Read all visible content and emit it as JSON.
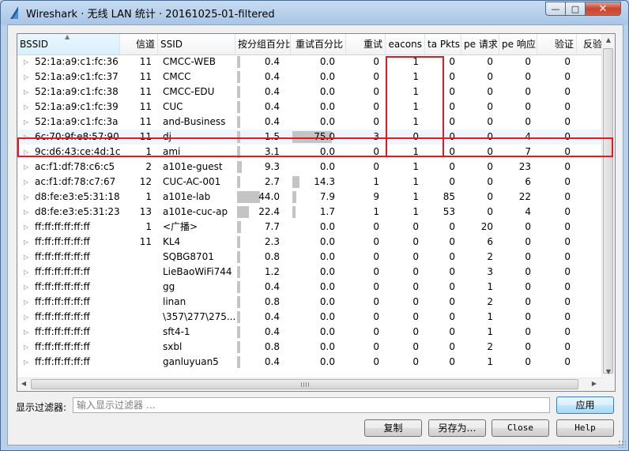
{
  "window": {
    "title": "Wireshark · 无线 LAN 统计 · 20161025-01-filtered",
    "minimize_glyph": "—",
    "maximize_glyph": "□",
    "close_glyph": "✕"
  },
  "columns": [
    "BSSID",
    "信道",
    "SSID",
    "按分组百分比",
    "重试百分比",
    "重试",
    "Beacons",
    "Data Pkts",
    "Probe 请求",
    "Probe 响应",
    "验证",
    "反验证"
  ],
  "columns_visible": [
    "BSSID",
    "信道",
    "SSID",
    "按分组百分比",
    "重试百分比",
    "重试",
    "eacons",
    "ta Pkts",
    "pe 请求",
    "pe 响应",
    "验证",
    "反验证"
  ],
  "sort_column": "BSSID",
  "highlighted_row_index": 5,
  "rows": [
    {
      "bssid": "52:1a:a9:c1:fc:36",
      "channel": "11",
      "ssid": "CMCC-WEB",
      "pct_packets": "0.4",
      "pct_retry": "0.0",
      "retry": "0",
      "beacons": "1",
      "data_pkts": "0",
      "probe_req": "0",
      "probe_resp": "0",
      "auth": "0",
      "deauth": "0",
      "pct_packets_value": 0.4,
      "pct_retry_value": 0.0
    },
    {
      "bssid": "52:1a:a9:c1:fc:37",
      "channel": "11",
      "ssid": "CMCC",
      "pct_packets": "0.4",
      "pct_retry": "0.0",
      "retry": "0",
      "beacons": "1",
      "data_pkts": "0",
      "probe_req": "0",
      "probe_resp": "0",
      "auth": "0",
      "deauth": "0",
      "pct_packets_value": 0.4,
      "pct_retry_value": 0.0
    },
    {
      "bssid": "52:1a:a9:c1:fc:38",
      "channel": "11",
      "ssid": "CMCC-EDU",
      "pct_packets": "0.4",
      "pct_retry": "0.0",
      "retry": "0",
      "beacons": "1",
      "data_pkts": "0",
      "probe_req": "0",
      "probe_resp": "0",
      "auth": "0",
      "deauth": "0",
      "pct_packets_value": 0.4,
      "pct_retry_value": 0.0
    },
    {
      "bssid": "52:1a:a9:c1:fc:39",
      "channel": "11",
      "ssid": "CUC",
      "pct_packets": "0.4",
      "pct_retry": "0.0",
      "retry": "0",
      "beacons": "1",
      "data_pkts": "0",
      "probe_req": "0",
      "probe_resp": "0",
      "auth": "0",
      "deauth": "0",
      "pct_packets_value": 0.4,
      "pct_retry_value": 0.0
    },
    {
      "bssid": "52:1a:a9:c1:fc:3a",
      "channel": "11",
      "ssid": "and-Business",
      "pct_packets": "0.4",
      "pct_retry": "0.0",
      "retry": "0",
      "beacons": "1",
      "data_pkts": "0",
      "probe_req": "0",
      "probe_resp": "0",
      "auth": "0",
      "deauth": "0",
      "pct_packets_value": 0.4,
      "pct_retry_value": 0.0
    },
    {
      "bssid": "6c:70:9f:e8:57:90",
      "channel": "11",
      "ssid": "dj",
      "pct_packets": "1.5",
      "pct_retry": "75.0",
      "retry": "3",
      "beacons": "0",
      "data_pkts": "0",
      "probe_req": "0",
      "probe_resp": "4",
      "auth": "0",
      "deauth": "0",
      "pct_packets_value": 1.5,
      "pct_retry_value": 75.0
    },
    {
      "bssid": "9c:d6:43:ce:4d:1c",
      "channel": "1",
      "ssid": "ami",
      "pct_packets": "3.1",
      "pct_retry": "0.0",
      "retry": "0",
      "beacons": "1",
      "data_pkts": "0",
      "probe_req": "0",
      "probe_resp": "7",
      "auth": "0",
      "deauth": "0",
      "pct_packets_value": 3.1,
      "pct_retry_value": 0.0
    },
    {
      "bssid": "ac:f1:df:78:c6:c5",
      "channel": "2",
      "ssid": "a101e-guest",
      "pct_packets": "9.3",
      "pct_retry": "0.0",
      "retry": "0",
      "beacons": "1",
      "data_pkts": "0",
      "probe_req": "0",
      "probe_resp": "23",
      "auth": "0",
      "deauth": "0",
      "pct_packets_value": 9.3,
      "pct_retry_value": 0.0
    },
    {
      "bssid": "ac:f1:df:78:c7:67",
      "channel": "12",
      "ssid": "CUC-AC-001",
      "pct_packets": "2.7",
      "pct_retry": "14.3",
      "retry": "1",
      "beacons": "1",
      "data_pkts": "0",
      "probe_req": "0",
      "probe_resp": "6",
      "auth": "0",
      "deauth": "0",
      "pct_packets_value": 2.7,
      "pct_retry_value": 14.3
    },
    {
      "bssid": "d8:fe:e3:e5:31:18",
      "channel": "1",
      "ssid": "a101e-lab",
      "pct_packets": "44.0",
      "pct_retry": "7.9",
      "retry": "9",
      "beacons": "1",
      "data_pkts": "85",
      "probe_req": "0",
      "probe_resp": "22",
      "auth": "0",
      "deauth": "0",
      "pct_packets_value": 44.0,
      "pct_retry_value": 7.9
    },
    {
      "bssid": "d8:fe:e3:e5:31:23",
      "channel": "13",
      "ssid": "a101e-cuc-ap",
      "pct_packets": "22.4",
      "pct_retry": "1.7",
      "retry": "1",
      "beacons": "1",
      "data_pkts": "53",
      "probe_req": "0",
      "probe_resp": "4",
      "auth": "0",
      "deauth": "0",
      "pct_packets_value": 22.4,
      "pct_retry_value": 1.7
    },
    {
      "bssid": "ff:ff:ff:ff:ff:ff",
      "channel": "1",
      "ssid": "<广播>",
      "pct_packets": "7.7",
      "pct_retry": "0.0",
      "retry": "0",
      "beacons": "0",
      "data_pkts": "0",
      "probe_req": "20",
      "probe_resp": "0",
      "auth": "0",
      "deauth": "0",
      "pct_packets_value": 7.7,
      "pct_retry_value": 0.0
    },
    {
      "bssid": "ff:ff:ff:ff:ff:ff",
      "channel": "11",
      "ssid": "KL4",
      "pct_packets": "2.3",
      "pct_retry": "0.0",
      "retry": "0",
      "beacons": "0",
      "data_pkts": "0",
      "probe_req": "6",
      "probe_resp": "0",
      "auth": "0",
      "deauth": "0",
      "pct_packets_value": 2.3,
      "pct_retry_value": 0.0
    },
    {
      "bssid": "ff:ff:ff:ff:ff:ff",
      "channel": "",
      "ssid": "SQBG8701",
      "pct_packets": "0.8",
      "pct_retry": "0.0",
      "retry": "0",
      "beacons": "0",
      "data_pkts": "0",
      "probe_req": "2",
      "probe_resp": "0",
      "auth": "0",
      "deauth": "0",
      "pct_packets_value": 0.8,
      "pct_retry_value": 0.0
    },
    {
      "bssid": "ff:ff:ff:ff:ff:ff",
      "channel": "",
      "ssid": "LieBaoWiFi744",
      "pct_packets": "1.2",
      "pct_retry": "0.0",
      "retry": "0",
      "beacons": "0",
      "data_pkts": "0",
      "probe_req": "3",
      "probe_resp": "0",
      "auth": "0",
      "deauth": "0",
      "pct_packets_value": 1.2,
      "pct_retry_value": 0.0
    },
    {
      "bssid": "ff:ff:ff:ff:ff:ff",
      "channel": "",
      "ssid": "gg",
      "pct_packets": "0.4",
      "pct_retry": "0.0",
      "retry": "0",
      "beacons": "0",
      "data_pkts": "0",
      "probe_req": "1",
      "probe_resp": "0",
      "auth": "0",
      "deauth": "0",
      "pct_packets_value": 0.4,
      "pct_retry_value": 0.0
    },
    {
      "bssid": "ff:ff:ff:ff:ff:ff",
      "channel": "",
      "ssid": "linan",
      "pct_packets": "0.8",
      "pct_retry": "0.0",
      "retry": "0",
      "beacons": "0",
      "data_pkts": "0",
      "probe_req": "2",
      "probe_resp": "0",
      "auth": "0",
      "deauth": "0",
      "pct_packets_value": 0.8,
      "pct_retry_value": 0.0
    },
    {
      "bssid": "ff:ff:ff:ff:ff:ff",
      "channel": "",
      "ssid": "\\357\\277\\275...",
      "pct_packets": "0.4",
      "pct_retry": "0.0",
      "retry": "0",
      "beacons": "0",
      "data_pkts": "0",
      "probe_req": "1",
      "probe_resp": "0",
      "auth": "0",
      "deauth": "0",
      "pct_packets_value": 0.4,
      "pct_retry_value": 0.0
    },
    {
      "bssid": "ff:ff:ff:ff:ff:ff",
      "channel": "",
      "ssid": "sft4-1",
      "pct_packets": "0.4",
      "pct_retry": "0.0",
      "retry": "0",
      "beacons": "0",
      "data_pkts": "0",
      "probe_req": "1",
      "probe_resp": "0",
      "auth": "0",
      "deauth": "0",
      "pct_packets_value": 0.4,
      "pct_retry_value": 0.0
    },
    {
      "bssid": "ff:ff:ff:ff:ff:ff",
      "channel": "",
      "ssid": "sxbl",
      "pct_packets": "0.8",
      "pct_retry": "0.0",
      "retry": "0",
      "beacons": "0",
      "data_pkts": "0",
      "probe_req": "2",
      "probe_resp": "0",
      "auth": "0",
      "deauth": "0",
      "pct_packets_value": 0.8,
      "pct_retry_value": 0.0
    },
    {
      "bssid": "ff:ff:ff:ff:ff:ff",
      "channel": "",
      "ssid": "ganluyuan5",
      "pct_packets": "0.4",
      "pct_retry": "0.0",
      "retry": "0",
      "beacons": "0",
      "data_pkts": "0",
      "probe_req": "1",
      "probe_resp": "0",
      "auth": "0",
      "deauth": "0",
      "pct_packets_value": 0.4,
      "pct_retry_value": 0.0
    }
  ],
  "filter": {
    "label": "显示过滤器:",
    "placeholder": "输入显示过滤器 …",
    "value": "",
    "apply_label": "应用"
  },
  "buttons": {
    "copy": "复制",
    "save_as": "另存为…",
    "close": "Close",
    "help": "Help"
  },
  "annotation_color": "#e01b24",
  "highlight_color": "#eef5fd"
}
